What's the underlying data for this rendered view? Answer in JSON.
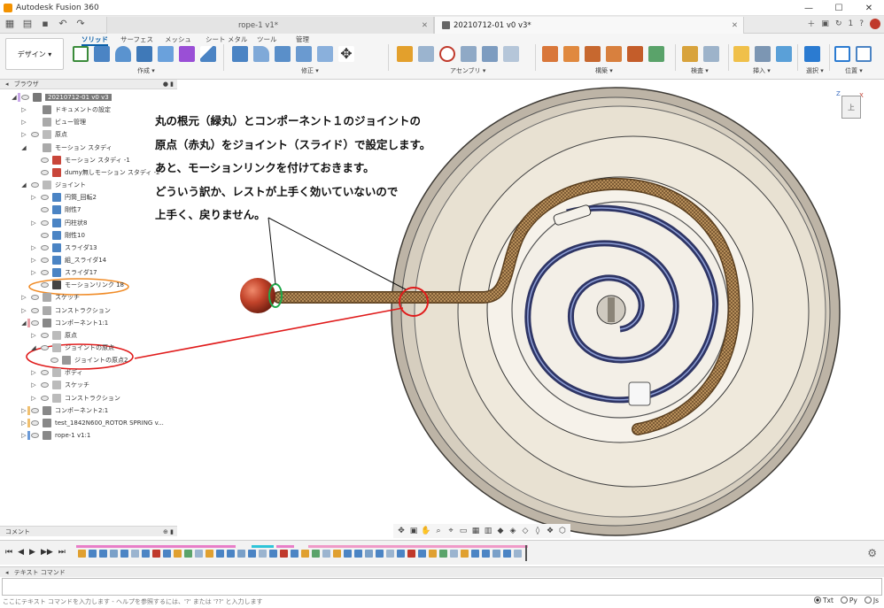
{
  "app": {
    "title": "Autodesk Fusion 360"
  },
  "window_controls": [
    "—",
    "☐",
    "✕"
  ],
  "doc_tabs": [
    {
      "label": "rope-1 v1*",
      "active": false
    },
    {
      "label": "20210712-01 v0 v3*",
      "active": true
    }
  ],
  "tabbar_right": {
    "count": "1"
  },
  "ribbon": {
    "workspace": "デザイン ▾",
    "tabs": [
      "ソリッド",
      "サーフェス",
      "メッシュ",
      "シート メタル",
      "ツール",
      "管理"
    ],
    "groups": [
      "作成 ▾",
      "修正 ▾",
      "アセンブリ ▾",
      "構築 ▾",
      "検査 ▾",
      "挿入 ▾",
      "選択 ▾",
      "位置 ▾"
    ]
  },
  "browser": {
    "header": "ブラウザ",
    "items": [
      {
        "label": "20210712-01 v0 v3"
      },
      {
        "label": "ドキュメントの設定"
      },
      {
        "label": "ビュー管理"
      },
      {
        "label": "原点"
      },
      {
        "label": "モーション スタディ"
      },
      {
        "label": "モーション スタディ -1"
      },
      {
        "label": "dumy無しモーション スタディ -2"
      },
      {
        "label": "ジョイント"
      },
      {
        "label": "円筒_回転2"
      },
      {
        "label": "剛性7"
      },
      {
        "label": "円柱状8"
      },
      {
        "label": "剛性10"
      },
      {
        "label": "スライダ13"
      },
      {
        "label": "組_スライダ14"
      },
      {
        "label": "スライダ17"
      },
      {
        "label": "モーションリンク 18"
      },
      {
        "label": "スケッチ"
      },
      {
        "label": "コンストラクション"
      },
      {
        "label": "コンポーネント1:1"
      },
      {
        "label": "原点"
      },
      {
        "label": "ジョイントの原点"
      },
      {
        "label": "ジョイントの原点2"
      },
      {
        "label": "ボディ"
      },
      {
        "label": "スケッチ"
      },
      {
        "label": "コンストラクション"
      },
      {
        "label": "コンポーネント2:1"
      },
      {
        "label": "test_1842N600_ROTOR SPRING v..."
      },
      {
        "label": "rope-1 v1:1"
      }
    ]
  },
  "annotation": {
    "lines": [
      "丸の根元（緑丸）とコンポーネント１のジョイントの",
      "原点（赤丸）をジョイント（スライド）で設定します。",
      "あと、モーションリンクを付けておきます。",
      "どういう訳か、レストが上手く効いていないので",
      "上手く、戻りません。"
    ]
  },
  "viewcube": {
    "face": "上",
    "axis_z": "Z",
    "axis_x": "X"
  },
  "comment_panel": {
    "label": "コメント"
  },
  "command_bar": {
    "header": "テキスト コマンド",
    "placeholder": "ここにテキスト コマンドを入力します - ヘルプを参照するには、'?' または '??' と入力します",
    "options": [
      {
        "label": "Txt",
        "selected": true
      },
      {
        "label": "Py",
        "selected": false
      },
      {
        "label": "Js",
        "selected": false
      }
    ]
  },
  "colors": {
    "accent": "#0a5fa8",
    "red_marker": "#e01b1b",
    "green_marker": "#1fa84a",
    "orange_marker": "#f08c28"
  }
}
